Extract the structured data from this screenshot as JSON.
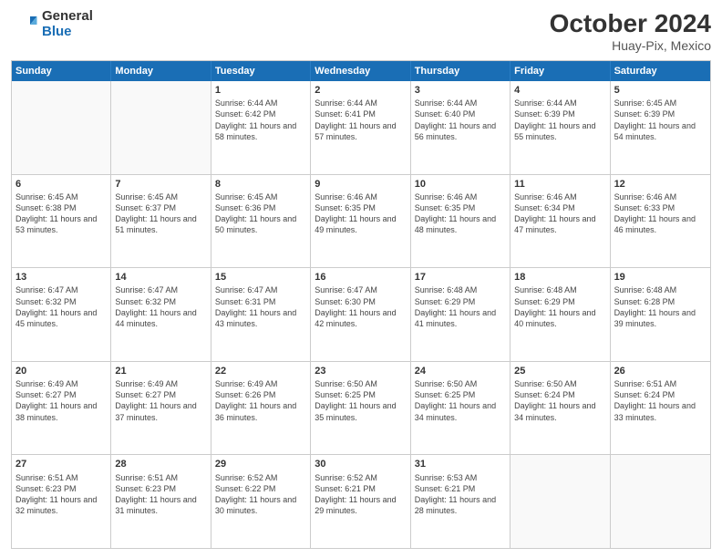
{
  "header": {
    "logo": {
      "general": "General",
      "blue": "Blue"
    },
    "title": "October 2024",
    "location": "Huay-Pix, Mexico"
  },
  "weekdays": [
    "Sunday",
    "Monday",
    "Tuesday",
    "Wednesday",
    "Thursday",
    "Friday",
    "Saturday"
  ],
  "rows": [
    [
      {
        "day": "",
        "empty": true
      },
      {
        "day": "",
        "empty": true
      },
      {
        "day": "1",
        "sunrise": "6:44 AM",
        "sunset": "6:42 PM",
        "daylight": "11 hours and 58 minutes."
      },
      {
        "day": "2",
        "sunrise": "6:44 AM",
        "sunset": "6:41 PM",
        "daylight": "11 hours and 57 minutes."
      },
      {
        "day": "3",
        "sunrise": "6:44 AM",
        "sunset": "6:40 PM",
        "daylight": "11 hours and 56 minutes."
      },
      {
        "day": "4",
        "sunrise": "6:44 AM",
        "sunset": "6:39 PM",
        "daylight": "11 hours and 55 minutes."
      },
      {
        "day": "5",
        "sunrise": "6:45 AM",
        "sunset": "6:39 PM",
        "daylight": "11 hours and 54 minutes."
      }
    ],
    [
      {
        "day": "6",
        "sunrise": "6:45 AM",
        "sunset": "6:38 PM",
        "daylight": "11 hours and 53 minutes."
      },
      {
        "day": "7",
        "sunrise": "6:45 AM",
        "sunset": "6:37 PM",
        "daylight": "11 hours and 51 minutes."
      },
      {
        "day": "8",
        "sunrise": "6:45 AM",
        "sunset": "6:36 PM",
        "daylight": "11 hours and 50 minutes."
      },
      {
        "day": "9",
        "sunrise": "6:46 AM",
        "sunset": "6:35 PM",
        "daylight": "11 hours and 49 minutes."
      },
      {
        "day": "10",
        "sunrise": "6:46 AM",
        "sunset": "6:35 PM",
        "daylight": "11 hours and 48 minutes."
      },
      {
        "day": "11",
        "sunrise": "6:46 AM",
        "sunset": "6:34 PM",
        "daylight": "11 hours and 47 minutes."
      },
      {
        "day": "12",
        "sunrise": "6:46 AM",
        "sunset": "6:33 PM",
        "daylight": "11 hours and 46 minutes."
      }
    ],
    [
      {
        "day": "13",
        "sunrise": "6:47 AM",
        "sunset": "6:32 PM",
        "daylight": "11 hours and 45 minutes."
      },
      {
        "day": "14",
        "sunrise": "6:47 AM",
        "sunset": "6:32 PM",
        "daylight": "11 hours and 44 minutes."
      },
      {
        "day": "15",
        "sunrise": "6:47 AM",
        "sunset": "6:31 PM",
        "daylight": "11 hours and 43 minutes."
      },
      {
        "day": "16",
        "sunrise": "6:47 AM",
        "sunset": "6:30 PM",
        "daylight": "11 hours and 42 minutes."
      },
      {
        "day": "17",
        "sunrise": "6:48 AM",
        "sunset": "6:29 PM",
        "daylight": "11 hours and 41 minutes."
      },
      {
        "day": "18",
        "sunrise": "6:48 AM",
        "sunset": "6:29 PM",
        "daylight": "11 hours and 40 minutes."
      },
      {
        "day": "19",
        "sunrise": "6:48 AM",
        "sunset": "6:28 PM",
        "daylight": "11 hours and 39 minutes."
      }
    ],
    [
      {
        "day": "20",
        "sunrise": "6:49 AM",
        "sunset": "6:27 PM",
        "daylight": "11 hours and 38 minutes."
      },
      {
        "day": "21",
        "sunrise": "6:49 AM",
        "sunset": "6:27 PM",
        "daylight": "11 hours and 37 minutes."
      },
      {
        "day": "22",
        "sunrise": "6:49 AM",
        "sunset": "6:26 PM",
        "daylight": "11 hours and 36 minutes."
      },
      {
        "day": "23",
        "sunrise": "6:50 AM",
        "sunset": "6:25 PM",
        "daylight": "11 hours and 35 minutes."
      },
      {
        "day": "24",
        "sunrise": "6:50 AM",
        "sunset": "6:25 PM",
        "daylight": "11 hours and 34 minutes."
      },
      {
        "day": "25",
        "sunrise": "6:50 AM",
        "sunset": "6:24 PM",
        "daylight": "11 hours and 34 minutes."
      },
      {
        "day": "26",
        "sunrise": "6:51 AM",
        "sunset": "6:24 PM",
        "daylight": "11 hours and 33 minutes."
      }
    ],
    [
      {
        "day": "27",
        "sunrise": "6:51 AM",
        "sunset": "6:23 PM",
        "daylight": "11 hours and 32 minutes."
      },
      {
        "day": "28",
        "sunrise": "6:51 AM",
        "sunset": "6:23 PM",
        "daylight": "11 hours and 31 minutes."
      },
      {
        "day": "29",
        "sunrise": "6:52 AM",
        "sunset": "6:22 PM",
        "daylight": "11 hours and 30 minutes."
      },
      {
        "day": "30",
        "sunrise": "6:52 AM",
        "sunset": "6:21 PM",
        "daylight": "11 hours and 29 minutes."
      },
      {
        "day": "31",
        "sunrise": "6:53 AM",
        "sunset": "6:21 PM",
        "daylight": "11 hours and 28 minutes."
      },
      {
        "day": "",
        "empty": true
      },
      {
        "day": "",
        "empty": true
      }
    ]
  ],
  "labels": {
    "sunrise": "Sunrise:",
    "sunset": "Sunset:",
    "daylight": "Daylight:"
  }
}
